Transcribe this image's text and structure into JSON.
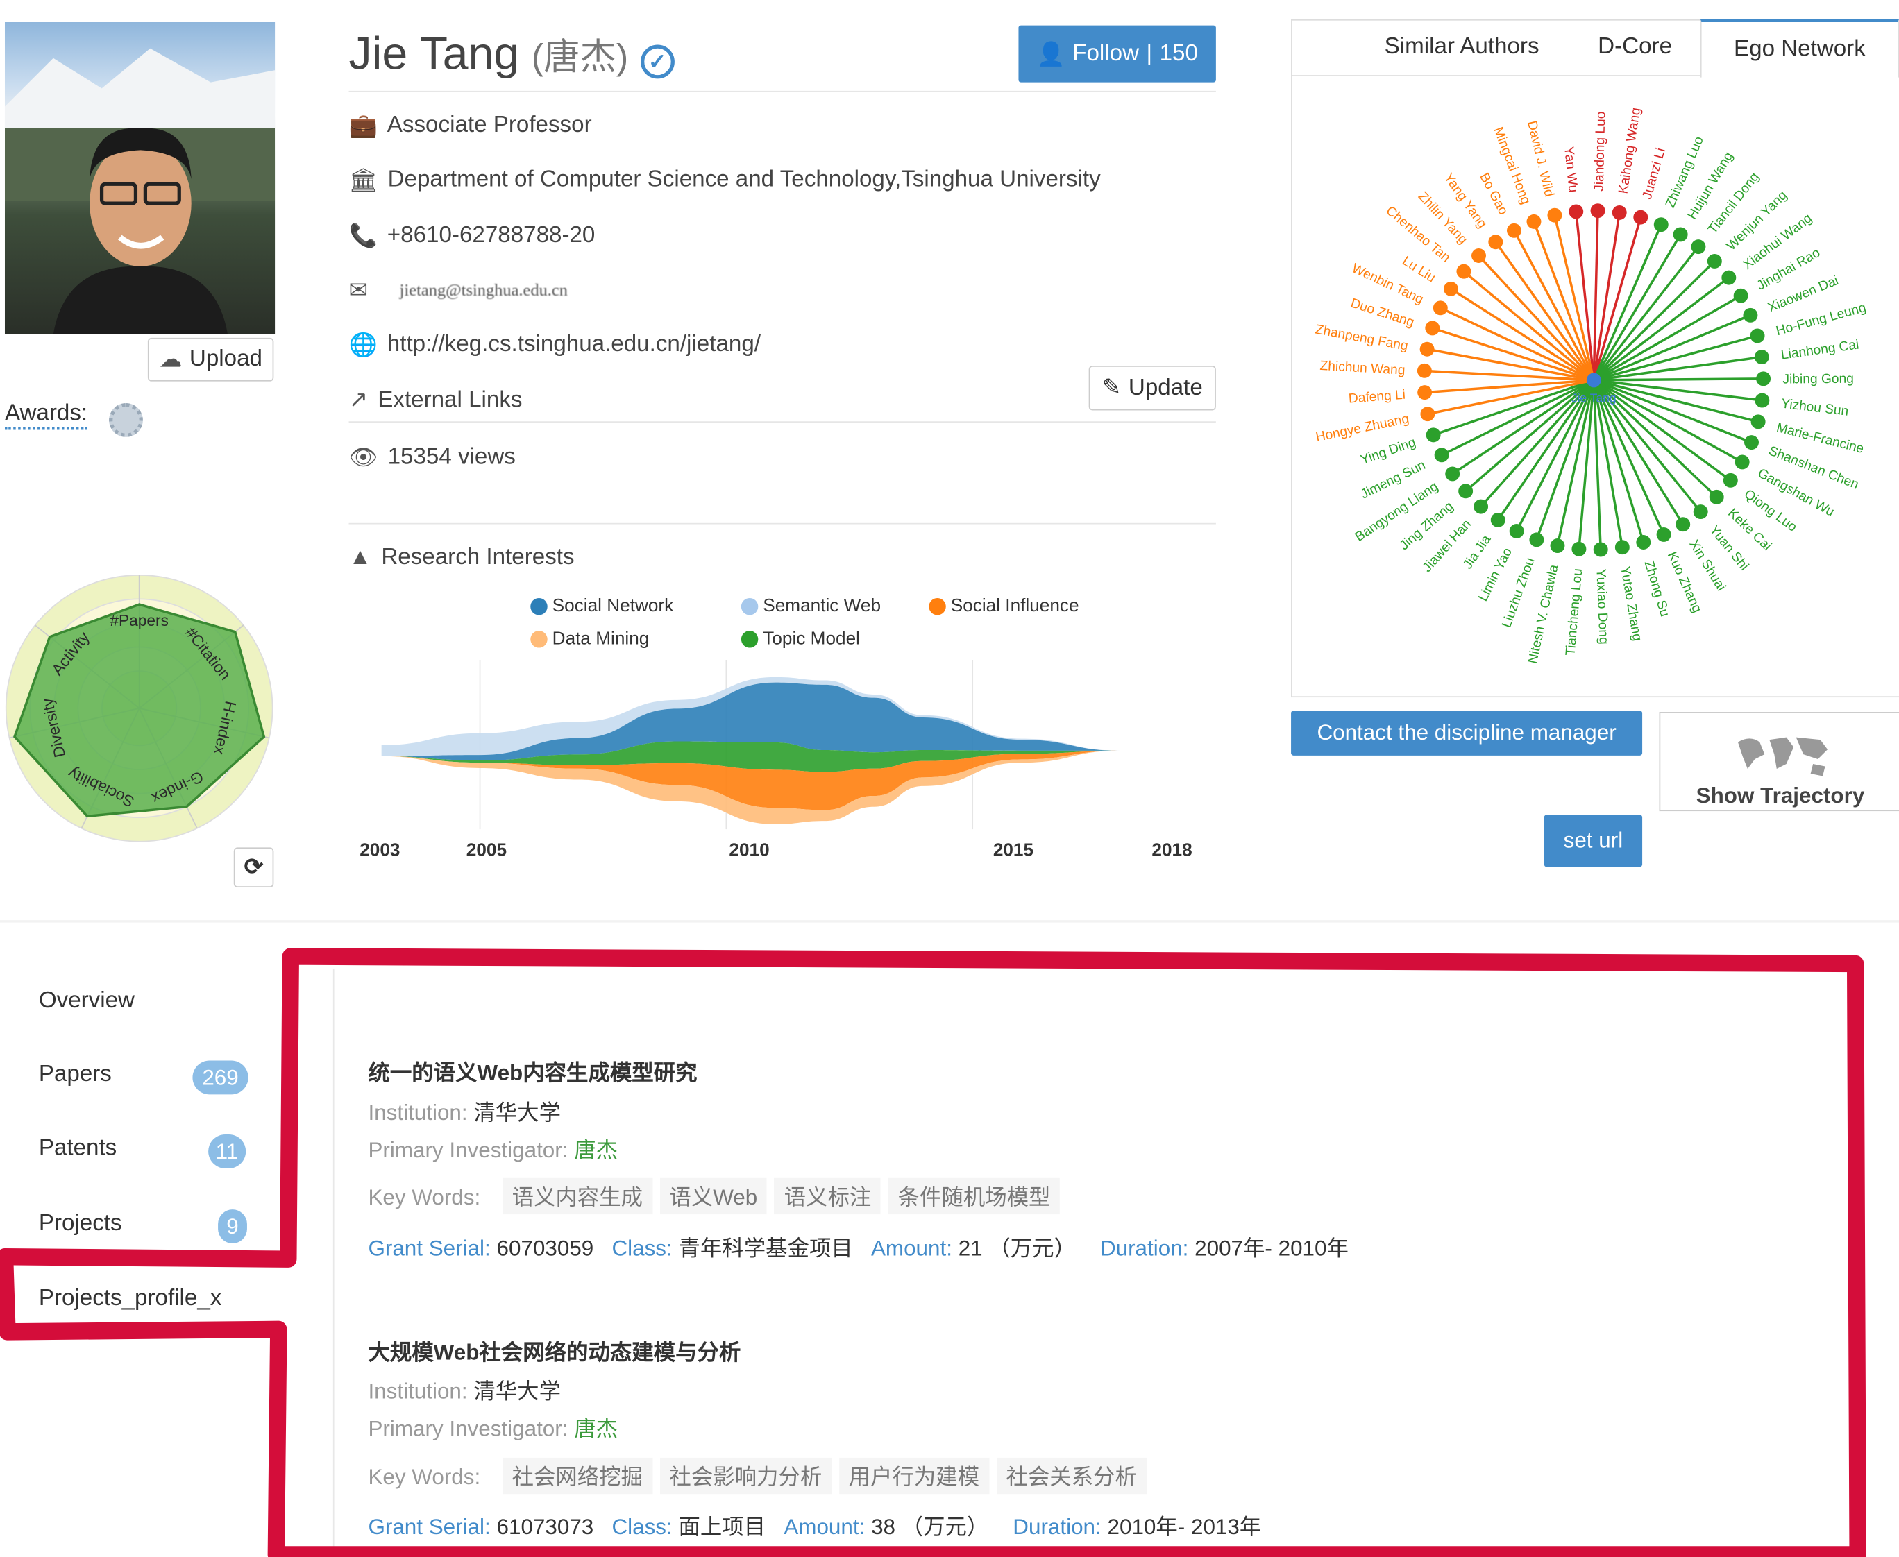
{
  "profile": {
    "name": "Jie Tang",
    "name_cn": "(唐杰)",
    "follow_label": "Follow",
    "follow_count": "150",
    "position": "Associate Professor",
    "affiliation": "Department of Computer Science and Technology,Tsinghua University",
    "phone": "+8610-62788788-20",
    "email": "jietang@tsinghua.edu.cn",
    "homepage": "http://keg.cs.tsinghua.edu.cn/jietang/",
    "external_links": "External Links",
    "update_label": "Update",
    "views": "15354 views",
    "upload_label": "Upload",
    "awards_label": "Awards:"
  },
  "radar": {
    "labels": [
      "#Papers",
      "#Citation",
      "H-index",
      "G-index",
      "Sociability",
      "Diversity",
      "Activity"
    ],
    "values": [
      0.78,
      0.92,
      0.96,
      0.82,
      0.9,
      0.96,
      0.86
    ]
  },
  "research": {
    "title": "Research Interests",
    "legend": [
      {
        "name": "Social Network",
        "color": "#2c7fb8"
      },
      {
        "name": "Semantic Web",
        "color": "#a6c8ec"
      },
      {
        "name": "Social Influence",
        "color": "#ff7f0e"
      },
      {
        "name": "Data Mining",
        "color": "#ffbb78"
      },
      {
        "name": "Topic Model",
        "color": "#2ca02c"
      }
    ],
    "years": [
      "2003",
      "2005",
      "2010",
      "2015",
      "2018"
    ]
  },
  "chart_data": {
    "type": "area",
    "x": [
      2003,
      2005,
      2007,
      2009,
      2011,
      2012,
      2013,
      2014,
      2016,
      2018
    ],
    "series": [
      {
        "name": "Social Network",
        "values": [
          0,
          0.5,
          1.5,
          3,
          5.5,
          6,
          5,
          3,
          1,
          0
        ]
      },
      {
        "name": "Semantic Web",
        "values": [
          1,
          2,
          1.5,
          0.8,
          0.5,
          0.4,
          0.3,
          0.2,
          0.1,
          0
        ]
      },
      {
        "name": "Topic Model",
        "values": [
          0,
          0.2,
          1,
          2,
          2.5,
          2,
          1.5,
          1,
          0.3,
          0
        ]
      },
      {
        "name": "Social Influence",
        "values": [
          0,
          0,
          0.3,
          2,
          3.5,
          3.5,
          2.5,
          1.5,
          0.5,
          0
        ]
      },
      {
        "name": "Data Mining",
        "values": [
          0,
          0.5,
          1,
          1.5,
          1.5,
          1,
          1,
          0.8,
          0.3,
          0
        ]
      }
    ]
  },
  "network_tabs": [
    "Similar Authors",
    "D-Core",
    "Ego Network"
  ],
  "network": {
    "center": "Jie Tang",
    "red": [
      "Yan Wu",
      "Jiandong Luo",
      "Kaihong Wang",
      "Juanzi Li"
    ],
    "orange": [
      "Hongye Zhuang",
      "Dafeng Li",
      "Zhichun Wang",
      "Zhanpeng Fang",
      "Duo Zhang",
      "Wenbin Tang",
      "Lu Liu",
      "Chenhao Tan",
      "Zhilin Yang",
      "Yang Yang",
      "Bo Gao",
      "Mingcai Hong",
      "David J. Wild"
    ],
    "green": [
      "Zhiwang Luo",
      "Huijun Wang",
      "Tiancil Dong",
      "Wenjun Yang",
      "Xiaohui Wang",
      "Jinghai Rao",
      "Xiaowen Dai",
      "Ho-Fung Leung",
      "Lianhong Cai",
      "Jibing Gong",
      "Yizhou Sun",
      "Marie-Francine",
      "Shanshan Chen",
      "Gangshan Wu",
      "Qiong Luo",
      "Keke Cai",
      "Yuan Shi",
      "Xin Shuai",
      "Kuo Zhang",
      "Zhong Su",
      "Yutao Zhang",
      "Yuxiao Dong",
      "Tiancheng Lou",
      "Nitesh V. Chawla",
      "Liuzhu Zhou",
      "Limin Yao",
      "Jia Jia",
      "Jiawei Han",
      "Jing Zhang",
      "Bangyong Liang",
      "Jimeng Sun",
      "Ying Ding"
    ]
  },
  "actions": {
    "contact": "Contact the discipline manager",
    "trajectory": "Show Trajectory",
    "set_url": "set url"
  },
  "sidenav": {
    "overview": "Overview",
    "papers": "Papers",
    "papers_count": "269",
    "patents": "Patents",
    "patents_count": "11",
    "projects": "Projects",
    "projects_count": "9",
    "profile_x": "Projects_profile_x"
  },
  "labels": {
    "institution": "Institution:",
    "pi": "Primary Investigator:",
    "keywords": "Key Words:",
    "grant": "Grant Serial:",
    "class": "Class:",
    "amount": "Amount:",
    "duration": "Duration:"
  },
  "projects": [
    {
      "title": "统一的语义Web内容生成模型研究",
      "institution": "清华大学",
      "pi": "唐杰",
      "keywords": [
        "语义内容生成",
        "语义Web",
        "语义标注",
        "条件随机场模型"
      ],
      "grant": "60703059",
      "class": "青年科学基金项目",
      "amount": "21 （万元）",
      "duration": "2007年- 2010年"
    },
    {
      "title": "大规模Web社会网络的动态建模与分析",
      "institution": "清华大学",
      "pi": "唐杰",
      "keywords": [
        "社会网络挖掘",
        "社会影响力分析",
        "用户行为建模",
        "社会关系分析"
      ],
      "grant": "61073073",
      "class": "面上项目",
      "amount": "38 （万元）",
      "duration": "2010年- 2013年"
    }
  ],
  "colors": {
    "accent": "#428bca",
    "highlight": "#d40d3a",
    "radar_fill": "#5bb04f",
    "net_green": "#2ca02c",
    "net_orange": "#ff7f0e",
    "net_red": "#d62728"
  }
}
